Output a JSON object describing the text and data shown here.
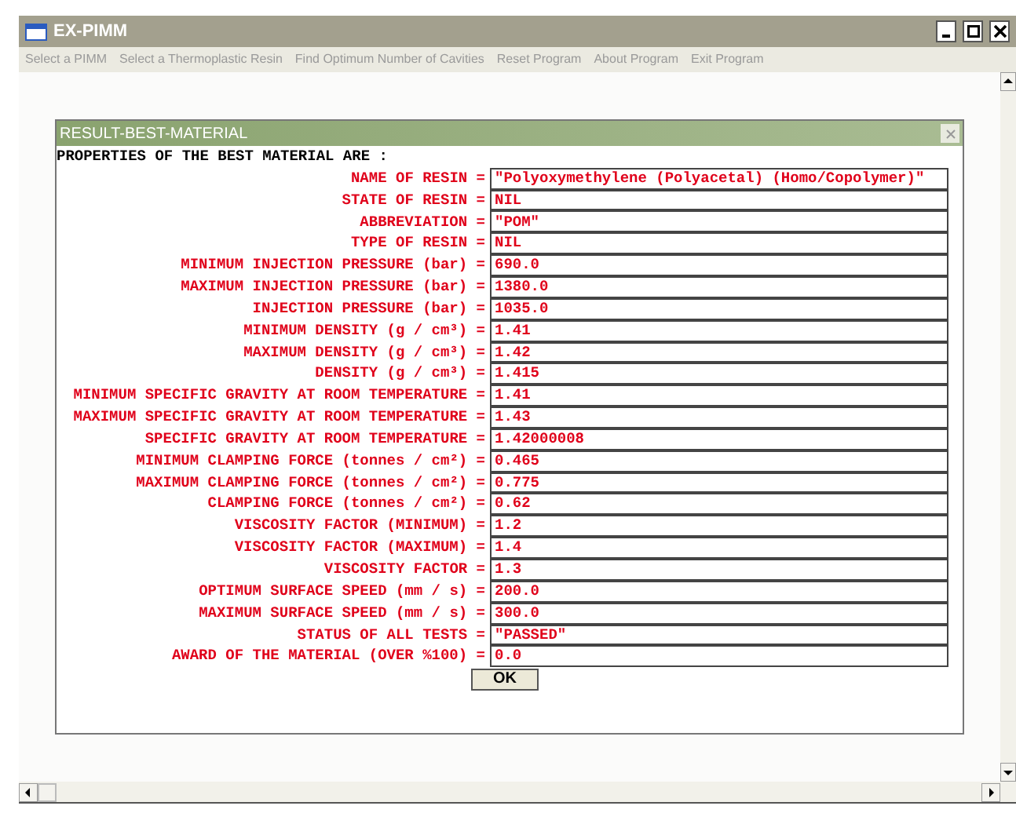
{
  "window": {
    "title": "EX-PIMM"
  },
  "menu": [
    "Select a PIMM",
    "Select a Thermoplastic Resin",
    "Find Optimum Number of Cavities",
    "Reset Program",
    "About Program",
    "Exit Program"
  ],
  "dialog": {
    "title": "RESULT-BEST-MATERIAL",
    "heading": "PROPERTIES OF THE BEST MATERIAL ARE :",
    "rows": [
      {
        "label": "NAME OF RESIN =",
        "value": "\"Polyoxymethylene (Polyacetal) (Homo/Copolymer)\""
      },
      {
        "label": "STATE OF RESIN =",
        "value": "NIL"
      },
      {
        "label": "ABBREVIATION =",
        "value": "\"POM\""
      },
      {
        "label": "TYPE OF RESIN =",
        "value": "NIL"
      },
      {
        "label": "MINIMUM INJECTION PRESSURE (bar) =",
        "value": "690.0"
      },
      {
        "label": "MAXIMUM INJECTION PRESSURE (bar) =",
        "value": "1380.0"
      },
      {
        "label": "INJECTION PRESSURE (bar) =",
        "value": "1035.0"
      },
      {
        "label": "MINIMUM DENSITY (g / cm³) =",
        "value": "1.41"
      },
      {
        "label": "MAXIMUM DENSITY (g / cm³) =",
        "value": "1.42"
      },
      {
        "label": "DENSITY (g / cm³) =",
        "value": "1.415"
      },
      {
        "label": "MINIMUM SPECIFIC GRAVITY AT ROOM TEMPERATURE =",
        "value": "1.41"
      },
      {
        "label": "MAXIMUM SPECIFIC GRAVITY AT ROOM TEMPERATURE =",
        "value": "1.43"
      },
      {
        "label": "SPECIFIC GRAVITY AT ROOM TEMPERATURE =",
        "value": "1.42000008"
      },
      {
        "label": "MINIMUM CLAMPING FORCE (tonnes / cm²) =",
        "value": "0.465"
      },
      {
        "label": "MAXIMUM CLAMPING FORCE (tonnes / cm²) =",
        "value": "0.775"
      },
      {
        "label": "CLAMPING FORCE (tonnes / cm²) =",
        "value": "0.62"
      },
      {
        "label": "VISCOSITY FACTOR (MINIMUM) =",
        "value": "1.2"
      },
      {
        "label": "VISCOSITY FACTOR (MAXIMUM) =",
        "value": "1.4"
      },
      {
        "label": "VISCOSITY FACTOR =",
        "value": "1.3"
      },
      {
        "label": "OPTIMUM SURFACE SPEED (mm / s) =",
        "value": "200.0"
      },
      {
        "label": "MAXIMUM SURFACE SPEED (mm / s) =",
        "value": "300.0"
      },
      {
        "label": "STATUS OF ALL TESTS =",
        "value": "\"PASSED\""
      },
      {
        "label": "AWARD OF THE MATERIAL (OVER %100) =",
        "value": "0.0"
      }
    ],
    "button": "OK"
  }
}
